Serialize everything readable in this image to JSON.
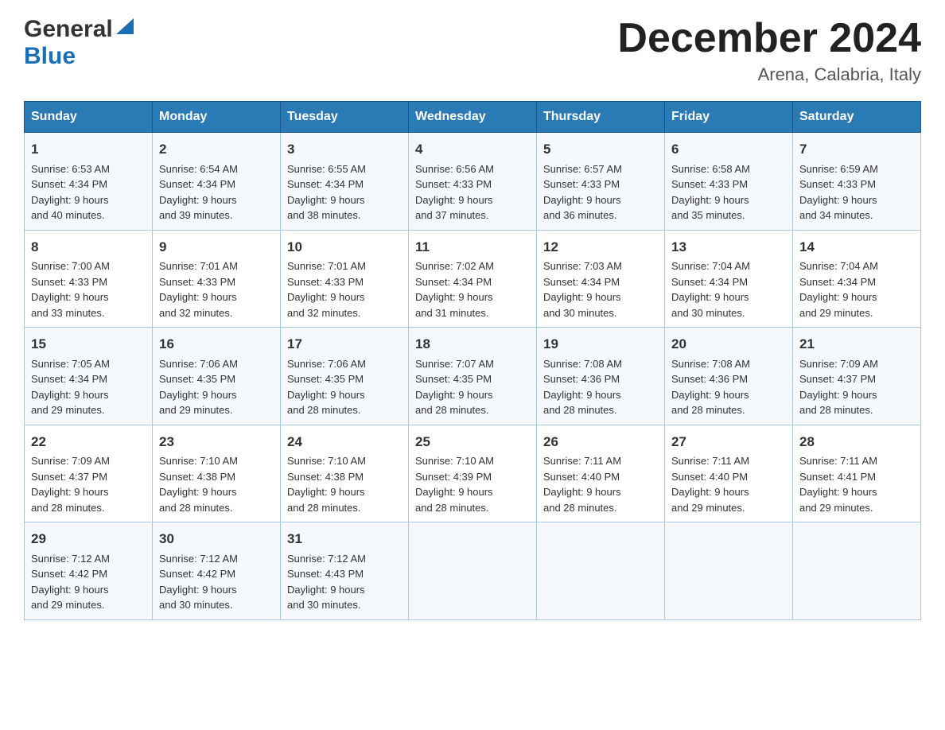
{
  "header": {
    "logo_general": "General",
    "logo_blue": "Blue",
    "month_title": "December 2024",
    "location": "Arena, Calabria, Italy"
  },
  "days_of_week": [
    "Sunday",
    "Monday",
    "Tuesday",
    "Wednesday",
    "Thursday",
    "Friday",
    "Saturday"
  ],
  "weeks": [
    [
      {
        "day": "1",
        "info": "Sunrise: 6:53 AM\nSunset: 4:34 PM\nDaylight: 9 hours\nand 40 minutes."
      },
      {
        "day": "2",
        "info": "Sunrise: 6:54 AM\nSunset: 4:34 PM\nDaylight: 9 hours\nand 39 minutes."
      },
      {
        "day": "3",
        "info": "Sunrise: 6:55 AM\nSunset: 4:34 PM\nDaylight: 9 hours\nand 38 minutes."
      },
      {
        "day": "4",
        "info": "Sunrise: 6:56 AM\nSunset: 4:33 PM\nDaylight: 9 hours\nand 37 minutes."
      },
      {
        "day": "5",
        "info": "Sunrise: 6:57 AM\nSunset: 4:33 PM\nDaylight: 9 hours\nand 36 minutes."
      },
      {
        "day": "6",
        "info": "Sunrise: 6:58 AM\nSunset: 4:33 PM\nDaylight: 9 hours\nand 35 minutes."
      },
      {
        "day": "7",
        "info": "Sunrise: 6:59 AM\nSunset: 4:33 PM\nDaylight: 9 hours\nand 34 minutes."
      }
    ],
    [
      {
        "day": "8",
        "info": "Sunrise: 7:00 AM\nSunset: 4:33 PM\nDaylight: 9 hours\nand 33 minutes."
      },
      {
        "day": "9",
        "info": "Sunrise: 7:01 AM\nSunset: 4:33 PM\nDaylight: 9 hours\nand 32 minutes."
      },
      {
        "day": "10",
        "info": "Sunrise: 7:01 AM\nSunset: 4:33 PM\nDaylight: 9 hours\nand 32 minutes."
      },
      {
        "day": "11",
        "info": "Sunrise: 7:02 AM\nSunset: 4:34 PM\nDaylight: 9 hours\nand 31 minutes."
      },
      {
        "day": "12",
        "info": "Sunrise: 7:03 AM\nSunset: 4:34 PM\nDaylight: 9 hours\nand 30 minutes."
      },
      {
        "day": "13",
        "info": "Sunrise: 7:04 AM\nSunset: 4:34 PM\nDaylight: 9 hours\nand 30 minutes."
      },
      {
        "day": "14",
        "info": "Sunrise: 7:04 AM\nSunset: 4:34 PM\nDaylight: 9 hours\nand 29 minutes."
      }
    ],
    [
      {
        "day": "15",
        "info": "Sunrise: 7:05 AM\nSunset: 4:34 PM\nDaylight: 9 hours\nand 29 minutes."
      },
      {
        "day": "16",
        "info": "Sunrise: 7:06 AM\nSunset: 4:35 PM\nDaylight: 9 hours\nand 29 minutes."
      },
      {
        "day": "17",
        "info": "Sunrise: 7:06 AM\nSunset: 4:35 PM\nDaylight: 9 hours\nand 28 minutes."
      },
      {
        "day": "18",
        "info": "Sunrise: 7:07 AM\nSunset: 4:35 PM\nDaylight: 9 hours\nand 28 minutes."
      },
      {
        "day": "19",
        "info": "Sunrise: 7:08 AM\nSunset: 4:36 PM\nDaylight: 9 hours\nand 28 minutes."
      },
      {
        "day": "20",
        "info": "Sunrise: 7:08 AM\nSunset: 4:36 PM\nDaylight: 9 hours\nand 28 minutes."
      },
      {
        "day": "21",
        "info": "Sunrise: 7:09 AM\nSunset: 4:37 PM\nDaylight: 9 hours\nand 28 minutes."
      }
    ],
    [
      {
        "day": "22",
        "info": "Sunrise: 7:09 AM\nSunset: 4:37 PM\nDaylight: 9 hours\nand 28 minutes."
      },
      {
        "day": "23",
        "info": "Sunrise: 7:10 AM\nSunset: 4:38 PM\nDaylight: 9 hours\nand 28 minutes."
      },
      {
        "day": "24",
        "info": "Sunrise: 7:10 AM\nSunset: 4:38 PM\nDaylight: 9 hours\nand 28 minutes."
      },
      {
        "day": "25",
        "info": "Sunrise: 7:10 AM\nSunset: 4:39 PM\nDaylight: 9 hours\nand 28 minutes."
      },
      {
        "day": "26",
        "info": "Sunrise: 7:11 AM\nSunset: 4:40 PM\nDaylight: 9 hours\nand 28 minutes."
      },
      {
        "day": "27",
        "info": "Sunrise: 7:11 AM\nSunset: 4:40 PM\nDaylight: 9 hours\nand 29 minutes."
      },
      {
        "day": "28",
        "info": "Sunrise: 7:11 AM\nSunset: 4:41 PM\nDaylight: 9 hours\nand 29 minutes."
      }
    ],
    [
      {
        "day": "29",
        "info": "Sunrise: 7:12 AM\nSunset: 4:42 PM\nDaylight: 9 hours\nand 29 minutes."
      },
      {
        "day": "30",
        "info": "Sunrise: 7:12 AM\nSunset: 4:42 PM\nDaylight: 9 hours\nand 30 minutes."
      },
      {
        "day": "31",
        "info": "Sunrise: 7:12 AM\nSunset: 4:43 PM\nDaylight: 9 hours\nand 30 minutes."
      },
      {
        "day": "",
        "info": ""
      },
      {
        "day": "",
        "info": ""
      },
      {
        "day": "",
        "info": ""
      },
      {
        "day": "",
        "info": ""
      }
    ]
  ]
}
